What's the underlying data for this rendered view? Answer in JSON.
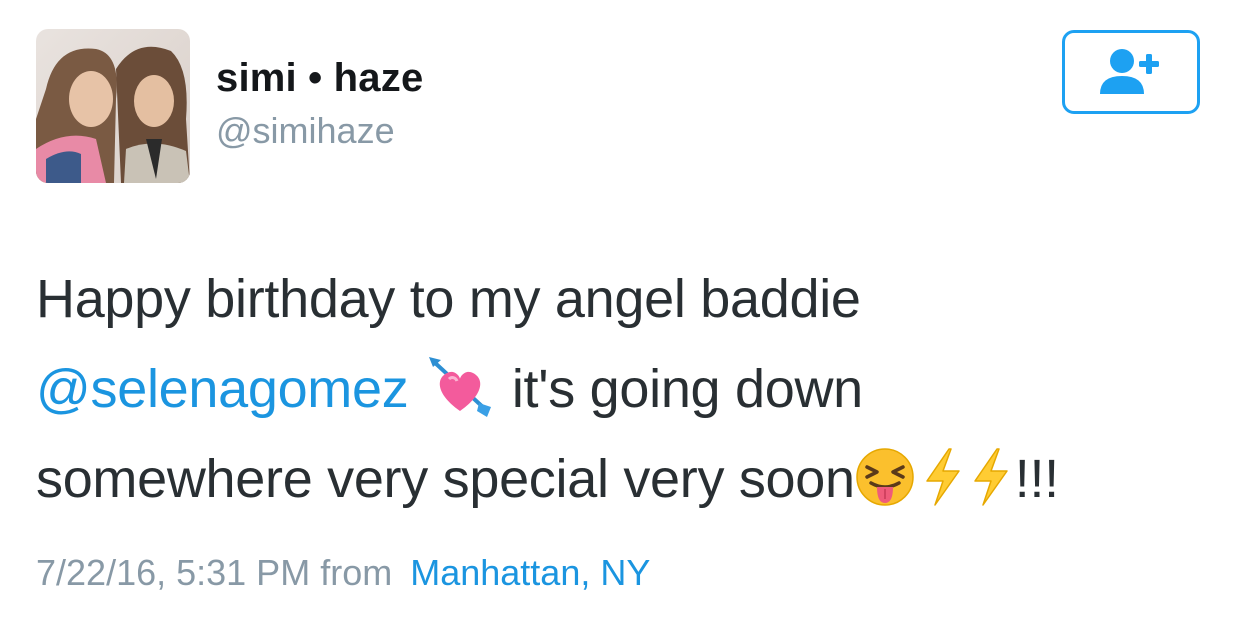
{
  "user": {
    "display_name": "simi • haze",
    "handle": "@simihaze",
    "avatar_icon": "profile-photo"
  },
  "follow_button": {
    "icon": "follow-user-plus-icon",
    "color": "#1da1f2"
  },
  "tweet": {
    "line1": "Happy birthday to my angel baddie",
    "mention": "@selenagomez",
    "line2_rest": "it's going down",
    "line3": "somewhere very special very soon",
    "exclamations": "!!!",
    "emojis": [
      "heart-with-arrow",
      "squinting-face-with-tongue",
      "high-voltage",
      "high-voltage"
    ]
  },
  "meta": {
    "timestamp": "7/22/16, 5:31 PM",
    "from_label": "from",
    "location": "Manhattan, NY"
  },
  "colors": {
    "text": "#292f33",
    "link": "#1b95e0",
    "secondary": "#8899a6"
  }
}
